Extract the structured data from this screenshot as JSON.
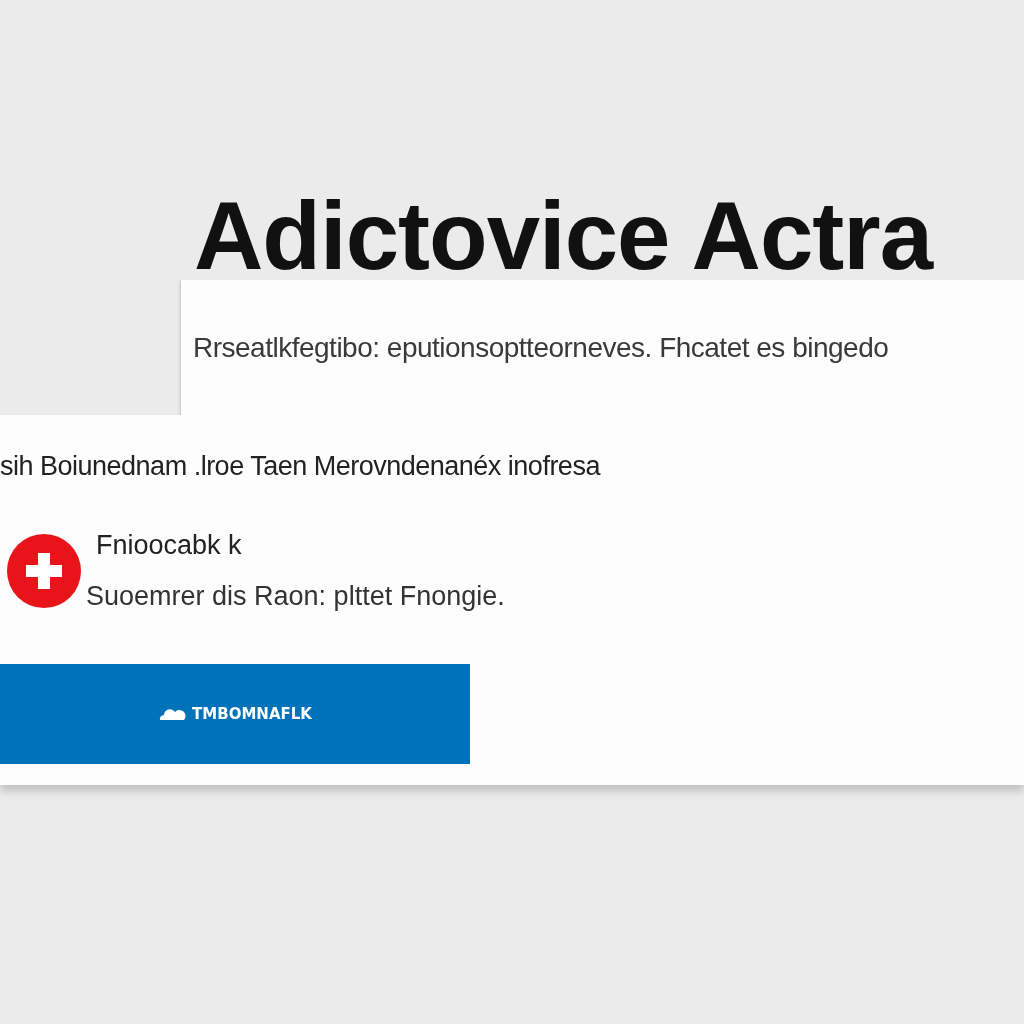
{
  "heading": "Adictovice Actra",
  "top_card": {
    "text": "Rrseatlkfegtibo: eputionsoptteorneves. Fhcatet es bingedo"
  },
  "main_card": {
    "text": "sih Boiunednam .lroe Taen Merovndenanéx inofresa",
    "alert": {
      "kind": "error",
      "title": "Fnioocabk k",
      "message": "Suoemrer dis Raon: plttet Fnongie."
    },
    "button": {
      "label": "TMBOMNAFLK"
    }
  }
}
